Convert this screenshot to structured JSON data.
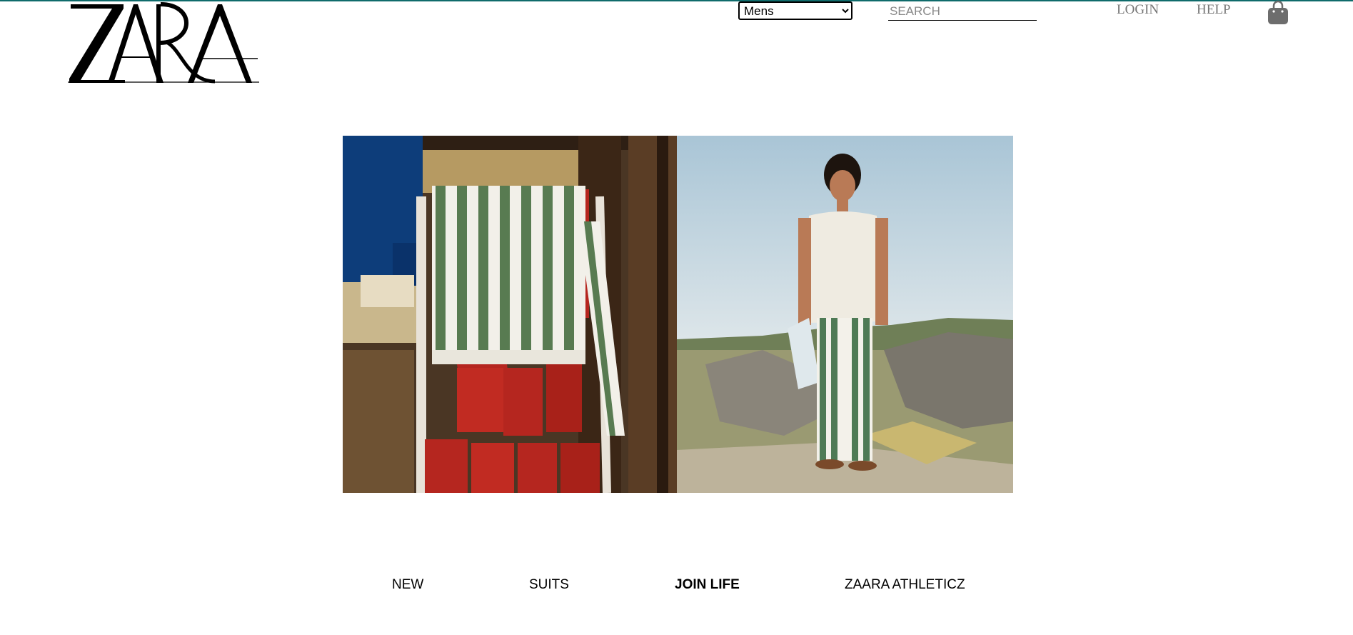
{
  "header": {
    "logo_text": "ZARA",
    "gender_select": {
      "selected": "Mens",
      "options": [
        "Mens"
      ]
    },
    "search": {
      "placeholder": "SEARCH",
      "value": ""
    },
    "login_label": "LOGIN",
    "help_label": "HELP"
  },
  "hero": {
    "left_image": "striped-trousers-on-chair",
    "right_image": "model-striped-trousers-outdoor"
  },
  "categories": [
    {
      "label": "NEW",
      "active": false
    },
    {
      "label": "SUITS",
      "active": false
    },
    {
      "label": "JOIN LIFE",
      "active": true
    },
    {
      "label": "ZAARA ATHLETICZ",
      "active": false
    }
  ],
  "colors": {
    "accent_line": "#0f6b6b",
    "header_link": "#777777",
    "bag_icon": "#6d6d6d"
  }
}
